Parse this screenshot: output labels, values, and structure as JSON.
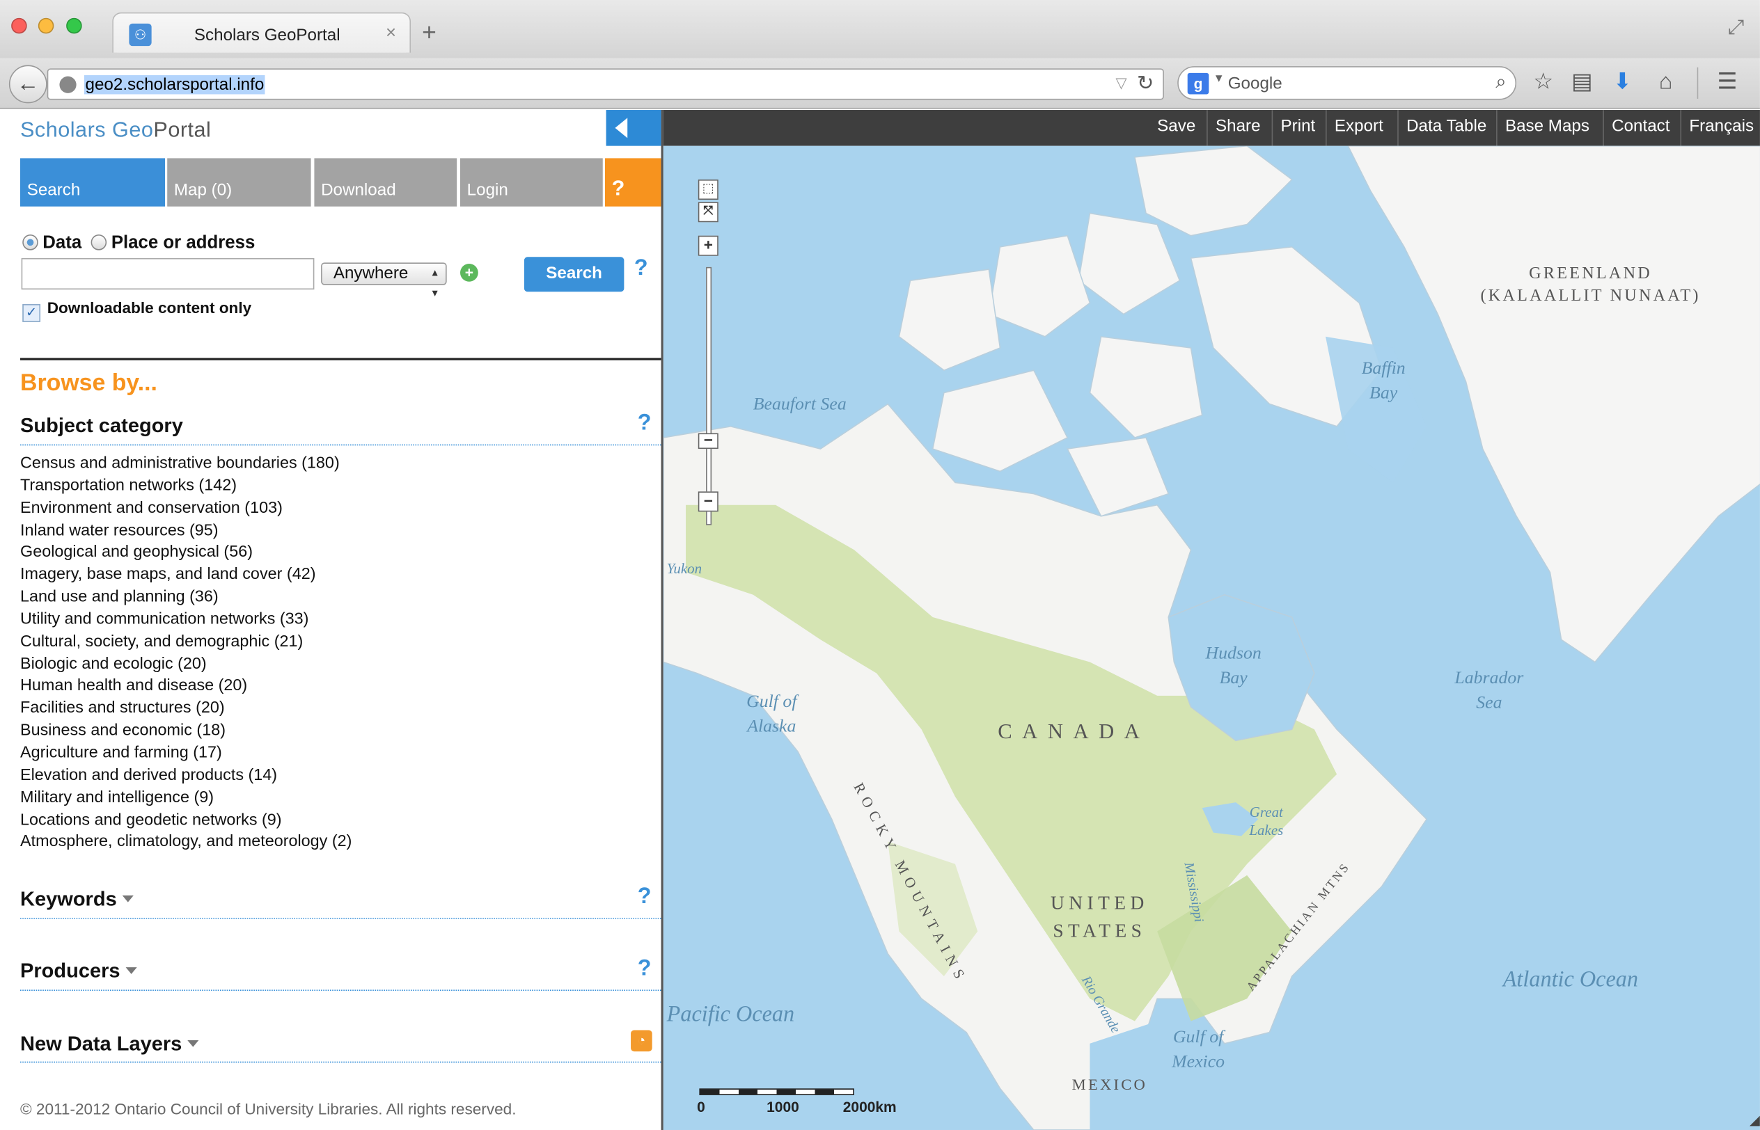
{
  "browser": {
    "tab_title": "Scholars GeoPortal",
    "tab_close": "×",
    "new_tab": "+",
    "url": "geo2.scholarsportal.info",
    "search_engine_icon": "g",
    "search_placeholder": "Google",
    "icons": [
      "back-icon",
      "globe-icon",
      "reload-icon",
      "search-icon",
      "bookmark-star-icon",
      "reader-icon",
      "download-icon",
      "home-icon",
      "menu-icon"
    ]
  },
  "sidebar": {
    "logo_blue": "Scholars Geo",
    "logo_gray": "Portal",
    "tabs": [
      {
        "label": "Search"
      },
      {
        "label": "Map (0)"
      },
      {
        "label": "Download"
      },
      {
        "label": "Login"
      },
      {
        "label": "?"
      }
    ],
    "search": {
      "radio_data": "Data",
      "radio_place": "Place or address",
      "query_value": "",
      "location_select": "Anywhere",
      "search_button": "Search",
      "help": "?",
      "downloadable_only": "Downloadable content only"
    },
    "browse_title": "Browse by...",
    "subject_heading": "Subject category",
    "categories": [
      "Census and administrative boundaries (180)",
      "Transportation networks (142)",
      "Environment and conservation (103)",
      "Inland water resources (95)",
      "Geological and geophysical (56)",
      "Imagery, base maps, and land cover (42)",
      "Land use and planning (36)",
      "Utility and communication networks (33)",
      "Cultural, society, and demographic (21)",
      "Biologic and ecologic (20)",
      "Human health and disease (20)",
      "Facilities and structures (20)",
      "Business and economic (18)",
      "Agriculture and farming (17)",
      "Elevation and derived products (14)",
      "Military and intelligence (9)",
      "Locations and geodetic networks (9)",
      "Atmosphere, climatology, and meteorology (2)"
    ],
    "keywords_heading": "Keywords",
    "producers_heading": "Producers",
    "new_layers_heading": "New Data Layers",
    "footer": "© 2011-2012 Ontario Council of University Libraries. All rights reserved."
  },
  "map": {
    "toolbar": [
      "Save",
      "Share",
      "Print",
      "Export",
      "Data Table",
      "Base Maps",
      "Contact",
      "Français"
    ],
    "labels": {
      "greenland_1": "GREENLAND",
      "greenland_2": "(KALAALLIT NUNAAT)",
      "baffin_1": "Baffin",
      "baffin_2": "Bay",
      "beaufort": "Beaufort Sea",
      "yukon": "Yukon",
      "hudson_1": "Hudson",
      "hudson_2": "Bay",
      "labrador_1": "Labrador",
      "labrador_2": "Sea",
      "gulf_alaska_1": "Gulf of",
      "gulf_alaska_2": "Alaska",
      "canada": "CANADA",
      "rocky": "ROCKY MOUNTAINS",
      "great_lakes_1": "Great",
      "great_lakes_2": "Lakes",
      "mississippi": "Mississippi",
      "appalachian": "APPALACHIAN MTNS",
      "us_1": "UNITED",
      "us_2": "STATES",
      "rio_grande": "Rio Grande",
      "pacific": "Pacific Ocean",
      "atlantic": "Atlantic Ocean",
      "gulf_mexico_1": "Gulf of",
      "gulf_mexico_2": "Mexico",
      "mexico": "MEXICO"
    },
    "zoom_in": "+",
    "zoom_out": "−",
    "scale": [
      "0",
      "1000",
      "2000km"
    ],
    "colors": {
      "water": "#a9d3ee",
      "land": "#f4f4f2",
      "vegetation": "#cfe0a8",
      "toolbar": "#3e3e3e",
      "accent": "#3b8fd8",
      "orange": "#f7931e"
    }
  }
}
